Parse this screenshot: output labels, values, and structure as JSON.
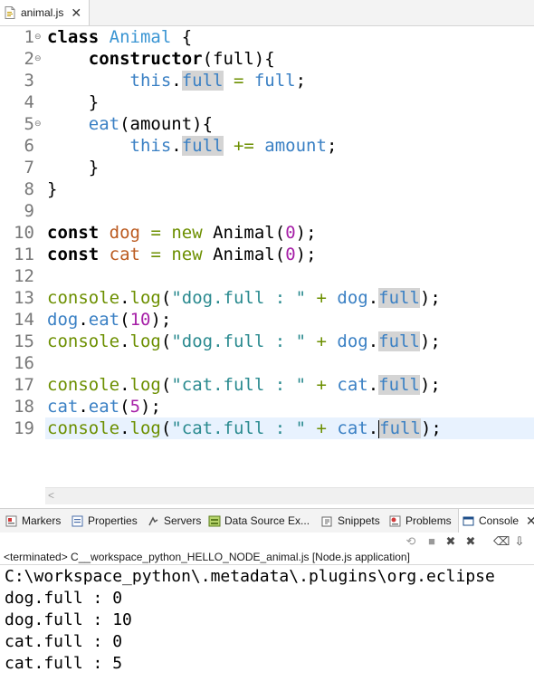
{
  "editor_tab": {
    "label": "animal.js",
    "close": "✕"
  },
  "code_lines": [
    {
      "no": "1",
      "fold": "⊖",
      "html": "<span class=\"kw\">class</span> <span class=\"cls\">Animal</span> {"
    },
    {
      "no": "2",
      "fold": "⊖",
      "html": "    <span class=\"kw\">constructor</span>(full){"
    },
    {
      "no": "3",
      "fold": "",
      "html": "        <span class=\"prop\">this</span>.<span class=\"prop hl\">full</span> <span class=\"op\">=</span> <span class=\"prop\">full</span>;"
    },
    {
      "no": "4",
      "fold": "",
      "html": "    }"
    },
    {
      "no": "5",
      "fold": "⊖",
      "html": "    <span class=\"mth\">eat</span>(amount){"
    },
    {
      "no": "6",
      "fold": "",
      "html": "        <span class=\"prop\">this</span>.<span class=\"prop hl\">full</span> <span class=\"op\">+=</span> <span class=\"prop\">amount</span>;"
    },
    {
      "no": "7",
      "fold": "",
      "html": "    }"
    },
    {
      "no": "8",
      "fold": "",
      "html": "}"
    },
    {
      "no": "9",
      "fold": "",
      "html": ""
    },
    {
      "no": "10",
      "fold": "",
      "html": "<span class=\"kw\">const</span> <span class=\"var\">dog</span> <span class=\"op\">=</span> <span class=\"op\">new</span> Animal(<span class=\"num\">0</span>);"
    },
    {
      "no": "11",
      "fold": "",
      "html": "<span class=\"kw\">const</span> <span class=\"var\">cat</span> <span class=\"op\">=</span> <span class=\"op\">new</span> Animal(<span class=\"num\">0</span>);"
    },
    {
      "no": "12",
      "fold": "",
      "html": ""
    },
    {
      "no": "13",
      "fold": "",
      "html": "<span class=\"obj\">console</span>.<span class=\"obj\">log</span>(<span class=\"str\">\"dog.full : \"</span> <span class=\"op\">+</span> <span class=\"prop\">dog</span>.<span class=\"prop hl\">full</span>);"
    },
    {
      "no": "14",
      "fold": "",
      "html": "<span class=\"prop\">dog</span>.<span class=\"prop\">eat</span>(<span class=\"num\">10</span>);"
    },
    {
      "no": "15",
      "fold": "",
      "html": "<span class=\"obj\">console</span>.<span class=\"obj\">log</span>(<span class=\"str\">\"dog.full : \"</span> <span class=\"op\">+</span> <span class=\"prop\">dog</span>.<span class=\"prop hl\">full</span>);"
    },
    {
      "no": "16",
      "fold": "",
      "html": ""
    },
    {
      "no": "17",
      "fold": "",
      "html": "<span class=\"obj\">console</span>.<span class=\"obj\">log</span>(<span class=\"str\">\"cat.full : \"</span> <span class=\"op\">+</span> <span class=\"prop\">cat</span>.<span class=\"prop hl\">full</span>);"
    },
    {
      "no": "18",
      "fold": "",
      "html": "<span class=\"prop\">cat</span>.<span class=\"prop\">eat</span>(<span class=\"num\">5</span>);"
    },
    {
      "no": "19",
      "fold": "",
      "html": "<span class=\"obj\">console</span>.<span class=\"obj\">log</span>(<span class=\"str\">\"cat.full : \"</span> <span class=\"op\">+</span> <span class=\"prop\">cat</span>.<span class=\"cursor\"></span><span class=\"prop hl\">full</span>);",
      "current": true
    }
  ],
  "views_tabs": {
    "markers": "Markers",
    "properties": "Properties",
    "servers": "Servers",
    "data_source": "Data Source Ex...",
    "snippets": "Snippets",
    "problems": "Problems",
    "console": "Console",
    "console_close": "✕"
  },
  "console_status": "<terminated> C__workspace_python_HELLO_NODE_animal.js [Node.js application]",
  "console_output": [
    "C:\\workspace_python\\.metadata\\.plugins\\org.eclipse",
    "dog.full : 0",
    "dog.full : 10",
    "cat.full : 0",
    "cat.full : 5"
  ],
  "scroll_arrow": "<"
}
